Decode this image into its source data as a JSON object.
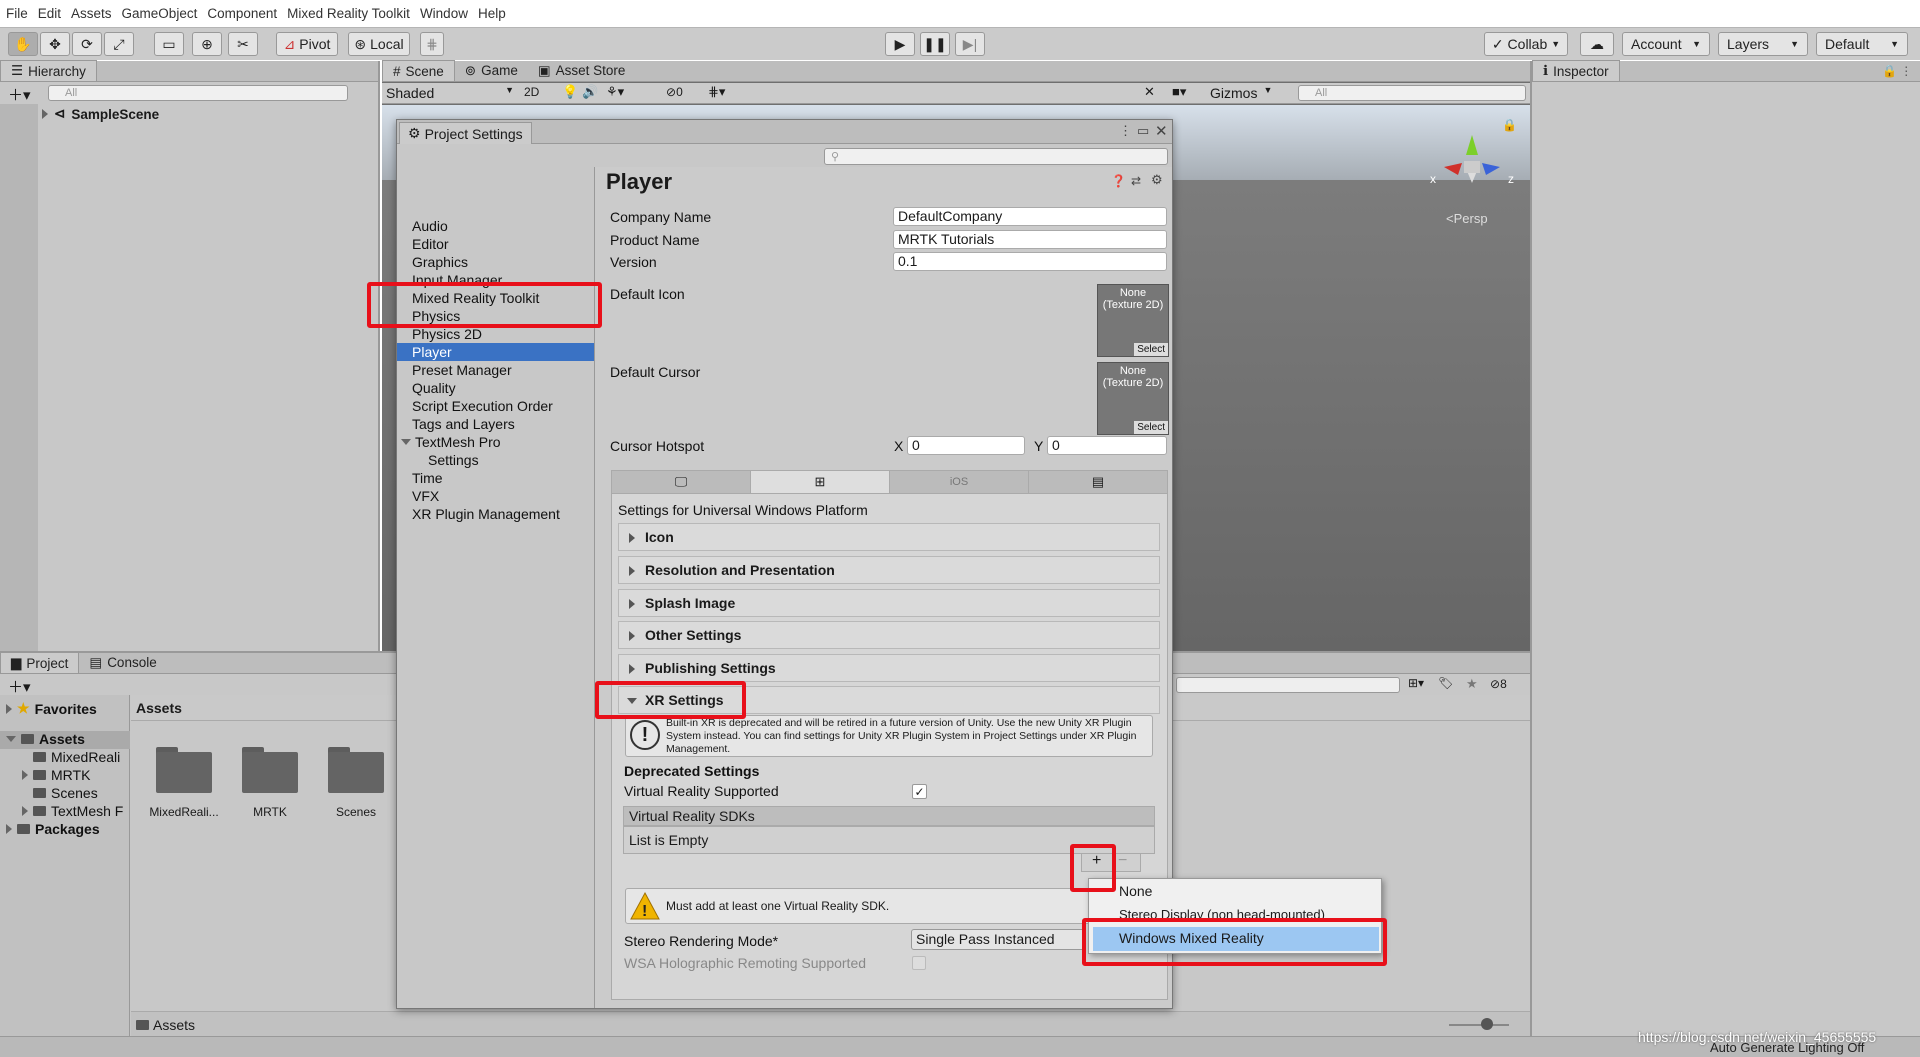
{
  "menu": [
    "File",
    "Edit",
    "Assets",
    "GameObject",
    "Component",
    "Mixed Reality Toolkit",
    "Window",
    "Help"
  ],
  "toolbar": {
    "pivot": "Pivot",
    "local": "Local",
    "collab": "Collab",
    "account": "Account",
    "layers": "Layers",
    "layout": "Default"
  },
  "hierarchy": {
    "tab": "Hierarchy",
    "search_placeholder": "All",
    "scene": "SampleScene"
  },
  "scene": {
    "tabs": [
      "Scene",
      "Game",
      "Asset Store"
    ],
    "shading": "Shaded",
    "mode2d": "2D",
    "hidden_count": "0",
    "gizmos": "Gizmos",
    "search_placeholder": "All",
    "persp": "Persp",
    "axis_x": "x",
    "axis_z": "z"
  },
  "inspector": {
    "tab": "Inspector"
  },
  "project": {
    "tabs": [
      "Project",
      "Console"
    ],
    "favorites": "Favorites",
    "assets": "Assets",
    "packages": "Packages",
    "tree": [
      "MixedReali",
      "MRTK",
      "Scenes",
      "TextMesh F"
    ],
    "header": "Assets",
    "folders": [
      "MixedReali...",
      "MRTK",
      "Scenes"
    ],
    "breadcrumb": "Assets",
    "count": "8"
  },
  "settings_window": {
    "title": "Project Settings",
    "categories": [
      "Audio",
      "Editor",
      "Graphics",
      "Input Manager",
      "Mixed Reality Toolkit",
      "Physics",
      "Physics 2D",
      "Player",
      "Preset Manager",
      "Quality",
      "Script Execution Order",
      "Tags and Layers",
      "TextMesh Pro",
      "Settings",
      "Time",
      "VFX",
      "XR Plugin Management"
    ],
    "selected": "Player",
    "player": {
      "title": "Player",
      "company_label": "Company Name",
      "company": "DefaultCompany",
      "product_label": "Product Name",
      "product": "MRTK Tutorials",
      "version_label": "Version",
      "version": "0.1",
      "icon_label": "Default Icon",
      "cursor_label": "Default Cursor",
      "tex_none": "None",
      "tex_type": "(Texture 2D)",
      "tex_select": "Select",
      "hotspot_label": "Cursor Hotspot",
      "hotspot_x_label": "X",
      "hotspot_x": "0",
      "hotspot_y_label": "Y",
      "hotspot_y": "0",
      "platform_ios": "iOS",
      "platform_heading": "Settings for Universal Windows Platform",
      "sections": [
        "Icon",
        "Resolution and Presentation",
        "Splash Image",
        "Other Settings",
        "Publishing Settings",
        "XR Settings"
      ],
      "xr_warning": "Built-in XR is deprecated and will be retired in a future version of Unity. Use the new Unity XR Plugin System instead. You can find settings for Unity XR Plugin System in Project Settings under XR Plugin Management.",
      "deprecated": "Deprecated Settings",
      "vr_supported": "Virtual Reality Supported",
      "vr_sdks": "Virtual Reality SDKs",
      "list_empty": "List is Empty",
      "sdk_warning": "Must add at least one Virtual Reality SDK.",
      "stereo_label": "Stereo Rendering Mode*",
      "stereo_value": "Single Pass Instanced",
      "wsa_label": "WSA Holographic Remoting Supported"
    }
  },
  "dropdown": {
    "items": [
      "None",
      "Stereo Display (non head-mounted)",
      "Windows Mixed Reality"
    ],
    "selected": "Windows Mixed Reality"
  },
  "status": {
    "lighting": "Auto Generate Lighting Off",
    "watermark": "https://blog.csdn.net/weixin_45655555"
  }
}
